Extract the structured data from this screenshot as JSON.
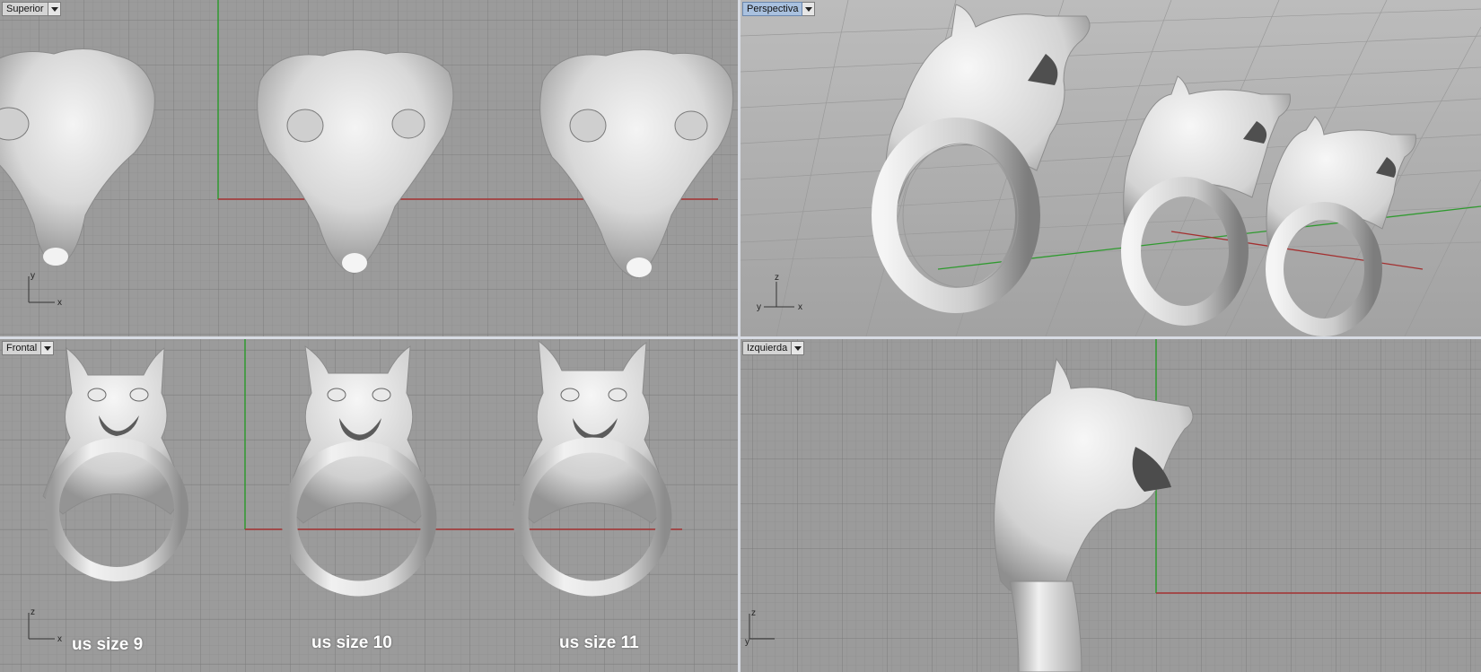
{
  "viewports": {
    "top": {
      "label": "Superior"
    },
    "perspective": {
      "label": "Perspectiva"
    },
    "front": {
      "label": "Frontal"
    },
    "left": {
      "label": "Izquierda"
    }
  },
  "axes": {
    "x": "x",
    "y": "y",
    "z": "z"
  },
  "size_labels": [
    "us size 9",
    "us size 10",
    "us size 11"
  ],
  "colors": {
    "grid_bg": "#9b9b9b",
    "x_axis": "#a33030",
    "y_axis": "#2f9a2f",
    "model": "#e6e6e6",
    "active_tab": "#a9c1df"
  },
  "models": {
    "icon": "wolf-ring-model"
  }
}
